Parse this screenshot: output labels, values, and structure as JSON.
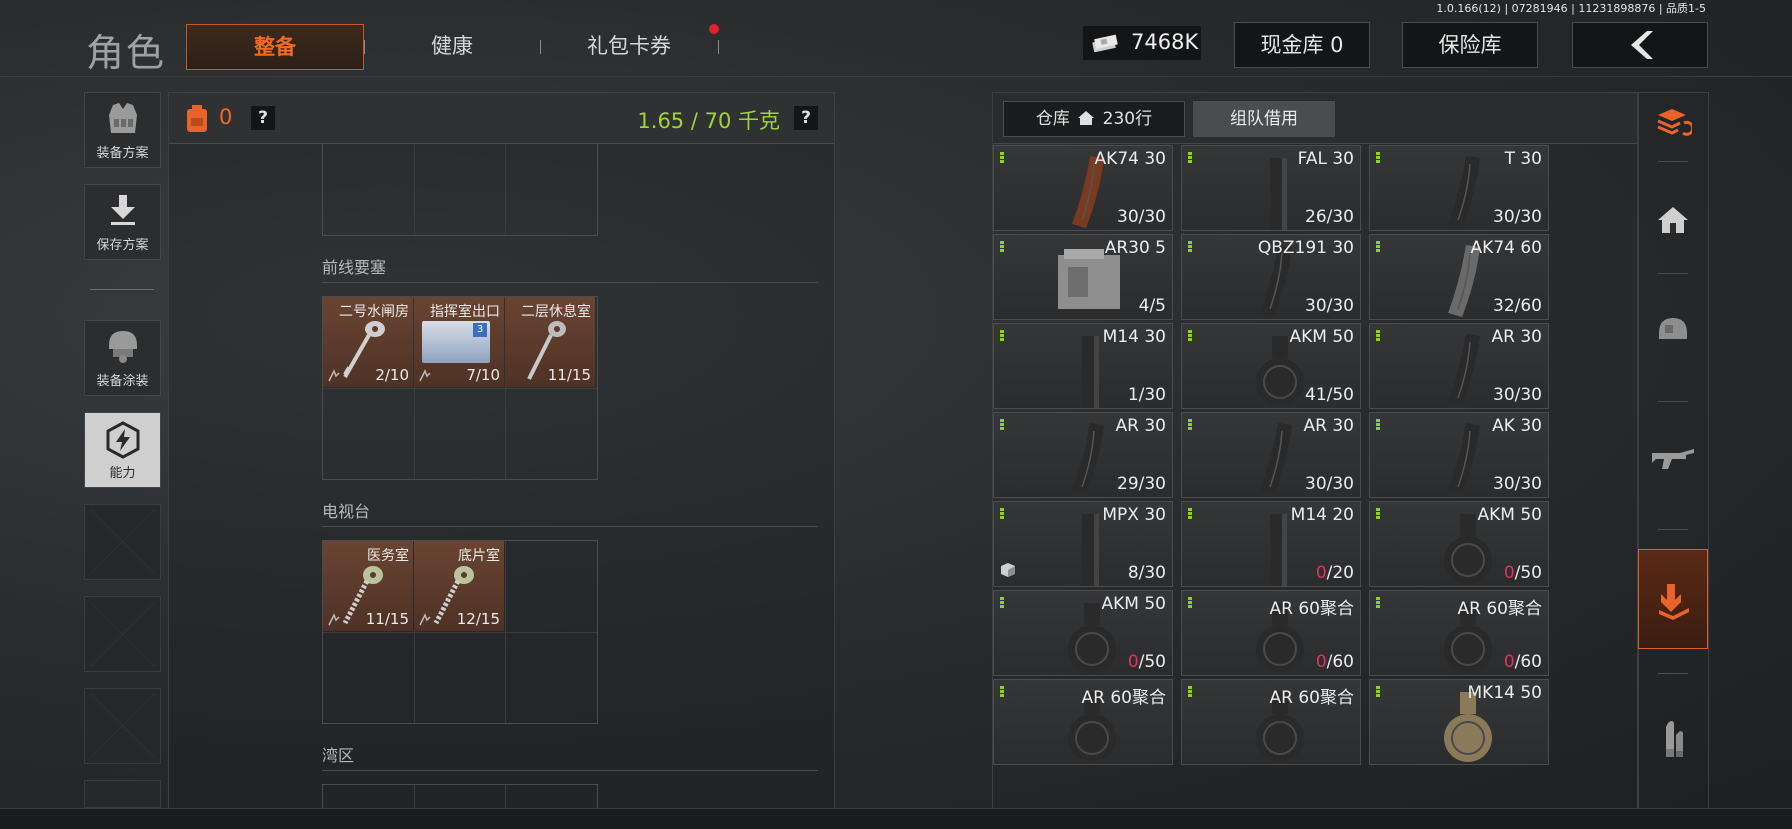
{
  "version": "1.0.166(12) | 07281946 | 11231898876 | 品质1-5",
  "header": {
    "title": "角色",
    "tabs": [
      {
        "label": "整备",
        "active": true
      },
      {
        "label": "健康",
        "active": false
      },
      {
        "label": "礼包卡券",
        "active": false,
        "notification": true
      }
    ],
    "money": {
      "icon": "cash-stack-icon",
      "value": "7468K"
    },
    "cash_vault": "现金库 0",
    "safe": "保险库",
    "back_icon": "chevron-left-icon"
  },
  "sidebar": {
    "items": [
      {
        "label": "装备方案",
        "icon": "vest-icon"
      },
      {
        "label": "保存方案",
        "icon": "download-icon"
      },
      {
        "label": "装备涂装",
        "icon": "helmet-icon"
      },
      {
        "label": "能力",
        "icon": "hexagon-bolt-icon",
        "active": true
      }
    ],
    "empty_slots": 4
  },
  "loadout": {
    "bag_icon": "backpack-icon",
    "count": "0",
    "help": "?",
    "weight": "1.65 / 70 千克",
    "sections": [
      {
        "title": "前线要塞",
        "keys": [
          {
            "name": "二号水闸房",
            "count": "2/10",
            "type": "key"
          },
          {
            "name": "指挥室出口",
            "count": "7/10",
            "type": "card",
            "card_num": "3"
          },
          {
            "name": "二层休息室",
            "count": "11/15",
            "type": "key"
          }
        ]
      },
      {
        "title": "电视台",
        "keys": [
          {
            "name": "医务室",
            "count": "11/15",
            "type": "key"
          },
          {
            "name": "底片室",
            "count": "12/15",
            "type": "key"
          }
        ]
      },
      {
        "title": "湾区",
        "keys": []
      }
    ]
  },
  "storage": {
    "tabs": [
      {
        "label": "仓库",
        "icon": "home-icon",
        "suffix": "230行"
      },
      {
        "label": "组队借用"
      }
    ],
    "items": [
      {
        "name": "AK74 30",
        "cur": "30",
        "max": "/30",
        "empty": false,
        "style": "banana-brown"
      },
      {
        "name": "FAL 30",
        "cur": "26",
        "max": "/30",
        "empty": false,
        "style": "straight-black"
      },
      {
        "name": "T 30",
        "cur": "30",
        "max": "/30",
        "empty": false,
        "style": "curved-black"
      },
      {
        "name": "AR30 5",
        "cur": "4",
        "max": "/5",
        "empty": false,
        "style": "box-gray"
      },
      {
        "name": "QBZ191 30",
        "cur": "30",
        "max": "/30",
        "empty": false,
        "style": "curved-black"
      },
      {
        "name": "AK74 60",
        "cur": "32",
        "max": "/60",
        "empty": false,
        "style": "quad-gray"
      },
      {
        "name": "M14 30",
        "cur": "1",
        "max": "/30",
        "empty": false,
        "style": "straight-black"
      },
      {
        "name": "AKM 50",
        "cur": "41",
        "max": "/50",
        "empty": false,
        "style": "drum"
      },
      {
        "name": "AR 30",
        "cur": "30",
        "max": "/30",
        "empty": false,
        "style": "curved-black"
      },
      {
        "name": "AR 30",
        "cur": "29",
        "max": "/30",
        "empty": false,
        "style": "curved-black"
      },
      {
        "name": "AR 30",
        "cur": "30",
        "max": "/30",
        "empty": false,
        "style": "curved-black"
      },
      {
        "name": "AK 30",
        "cur": "30",
        "max": "/30",
        "empty": false,
        "style": "banana-black"
      },
      {
        "name": "MPX 30",
        "cur": "8",
        "max": "/30",
        "empty": false,
        "style": "thin-black",
        "cube": true
      },
      {
        "name": "M14 20",
        "cur": "0",
        "max": "/20",
        "empty": true,
        "style": "straight-black"
      },
      {
        "name": "AKM 50",
        "cur": "0",
        "max": "/50",
        "empty": true,
        "style": "drum"
      },
      {
        "name": "AKM 50",
        "cur": "0",
        "max": "/50",
        "empty": true,
        "style": "drum"
      },
      {
        "name": "AR 60聚合",
        "cur": "0",
        "max": "/60",
        "empty": true,
        "style": "drum"
      },
      {
        "name": "AR 60聚合",
        "cur": "0",
        "max": "/60",
        "empty": true,
        "style": "drum"
      },
      {
        "name": "AR 60聚合",
        "cur": "",
        "max": "",
        "empty": false,
        "style": "drum"
      },
      {
        "name": "AR 60聚合",
        "cur": "",
        "max": "",
        "empty": false,
        "style": "drum"
      },
      {
        "name": "MK14 50",
        "cur": "",
        "max": "",
        "empty": false,
        "style": "drum-tan"
      }
    ]
  },
  "right_sidebar": [
    "stack-refresh-icon",
    "home-icon",
    "helmet-icon",
    "rifle-icon",
    "tray-download-icon",
    "ammo-icon"
  ],
  "colors": {
    "accent": "#f06a24",
    "weight": "#9fd53a",
    "empty": "#e5305a",
    "key_cell": "#5c3a2c"
  }
}
